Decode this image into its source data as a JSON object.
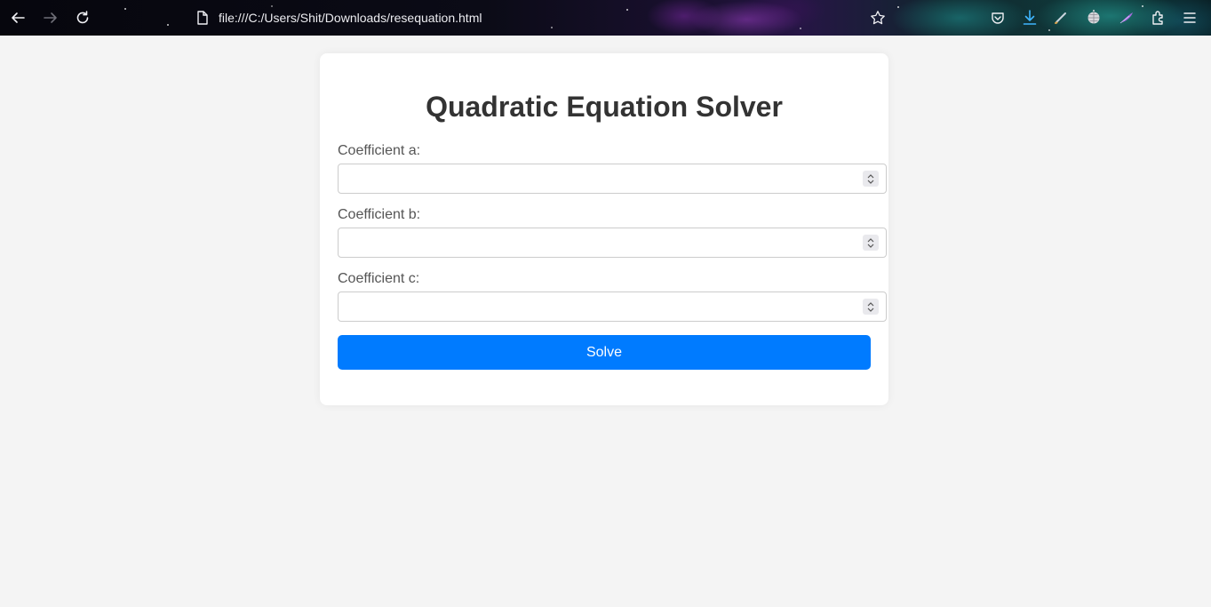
{
  "browser": {
    "url": "file:///C:/Users/Shit/Downloads/resequation.html",
    "icons": [
      "back-icon",
      "forward-icon",
      "reload-icon",
      "page-icon",
      "bookmark-star-icon",
      "pocket-icon",
      "download-icon",
      "extension-pen-icon",
      "extension-globe-icon",
      "extension-feather-icon",
      "extensions-puzzle-icon",
      "menu-icon"
    ]
  },
  "app": {
    "title": "Quadratic Equation Solver",
    "fields": [
      {
        "label": "Coefficient a:",
        "value": "",
        "placeholder": ""
      },
      {
        "label": "Coefficient b:",
        "value": "",
        "placeholder": ""
      },
      {
        "label": "Coefficient c:",
        "value": "",
        "placeholder": ""
      }
    ],
    "solve_label": "Solve"
  },
  "colors": {
    "accent": "#007bff",
    "background": "#f4f4f4",
    "card": "#ffffff",
    "title_text": "#333333",
    "label_text": "#555555"
  }
}
